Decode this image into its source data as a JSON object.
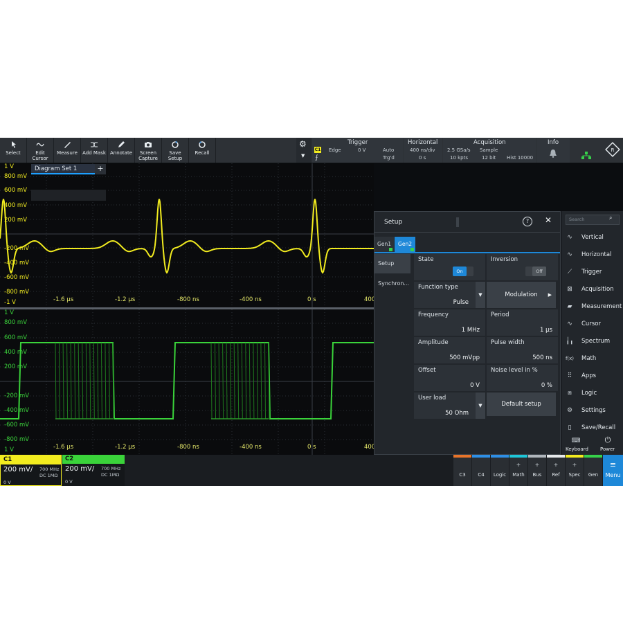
{
  "toolbar": {
    "buttons": [
      {
        "label": "Select",
        "icon": "pointer-icon"
      },
      {
        "label": "Edit Cursor",
        "icon": "cursor-wave-icon"
      },
      {
        "label": "Measure",
        "icon": "ruler-icon"
      },
      {
        "label": "Add Mask",
        "icon": "mask-icon"
      },
      {
        "label": "Annotate",
        "icon": "pencil-icon"
      },
      {
        "label": "Screen Capture",
        "icon": "camera-icon"
      },
      {
        "label": "Save Setup",
        "icon": "save-icon"
      },
      {
        "label": "Recall",
        "icon": "recall-icon"
      }
    ],
    "trigger": {
      "title": "Trigger",
      "channel": "C1",
      "type": "Edge",
      "level": "0 V",
      "mode": "Auto",
      "status": "Trg'd"
    },
    "horizontal": {
      "title": "Horizontal",
      "scale": "400 ns/div",
      "position": "0 s"
    },
    "acquisition": {
      "title": "Acquisition",
      "rate": "2.5 GSa/s",
      "points": "10 kpts",
      "mode": "Sample",
      "bits": "12 bit",
      "hist": "Hist 10000"
    },
    "info": {
      "title": "Info"
    }
  },
  "diagram_tab": {
    "label": "Diagram Set 1",
    "plus": "+"
  },
  "diag1": {
    "y_labels": [
      "1 V",
      "800 mV",
      "600 mV",
      "400 mV",
      "200 mV",
      "-200 mV",
      "-400 mV",
      "-600 mV",
      "-800 mV",
      "-1 V"
    ],
    "x_labels": [
      "-1.6 µs",
      "-1.2 µs",
      "-800 ns",
      "-400 ns",
      "0 s",
      "400"
    ]
  },
  "diag2": {
    "y_labels": [
      "1 V",
      "800 mV",
      "600 mV",
      "400 mV",
      "200 mV",
      "-200 mV",
      "-400 mV",
      "-600 mV",
      "-800 mV",
      "1 V"
    ],
    "x_labels": [
      "-1.6 µs",
      "-1.2 µs",
      "-800 ns",
      "-400 ns",
      "0 s",
      "400"
    ]
  },
  "setup": {
    "title": "Setup",
    "gen_tabs": [
      "Gen1",
      "Gen2"
    ],
    "side": [
      "Setup",
      "Synchron..."
    ],
    "state": {
      "label": "State",
      "on": "On"
    },
    "inversion": {
      "label": "Inversion",
      "off": "Off"
    },
    "function_type": {
      "label": "Function type",
      "value": "Pulse"
    },
    "modulation": {
      "label": "Modulation"
    },
    "frequency": {
      "label": "Frequency",
      "value": "1 MHz"
    },
    "period": {
      "label": "Period",
      "value": "1 µs"
    },
    "amplitude": {
      "label": "Amplitude",
      "value": "500 mVpp"
    },
    "pulse_width": {
      "label": "Pulse width",
      "value": "500 ns"
    },
    "offset": {
      "label": "Offset",
      "value": "0 V"
    },
    "noise": {
      "label": "Noise level in %",
      "value": "0 %"
    },
    "user_load": {
      "label": "User load",
      "value": "50 Ohm"
    },
    "default_setup": {
      "label": "Default setup"
    }
  },
  "menu": {
    "search_placeholder": "Search",
    "items": [
      {
        "label": "Vertical",
        "icon": "sine-icon"
      },
      {
        "label": "Horizontal",
        "icon": "sine-icon"
      },
      {
        "label": "Trigger",
        "icon": "trigger-icon"
      },
      {
        "label": "Acquisition",
        "icon": "acquisition-icon"
      },
      {
        "label": "Measurement",
        "icon": "ruler-icon"
      },
      {
        "label": "Cursor",
        "icon": "cursor-wave-icon"
      },
      {
        "label": "Spectrum",
        "icon": "spectrum-icon"
      },
      {
        "label": "Math",
        "icon": "math-icon"
      },
      {
        "label": "Apps",
        "icon": "apps-icon"
      },
      {
        "label": "Logic",
        "icon": "logic-icon"
      },
      {
        "label": "Settings",
        "icon": "gear-icon"
      },
      {
        "label": "Save/Recall",
        "icon": "file-icon"
      }
    ],
    "keyboard": "Keyboard",
    "power": "Power",
    "menu_label": "Menu"
  },
  "channels": [
    {
      "name": "C1",
      "scale": "200 mV/",
      "bw": "700 MHz",
      "coupling": "DC 1MΩ",
      "offset": "0 V",
      "color": "#f2ec1f"
    },
    {
      "name": "C2",
      "scale": "200 mV/",
      "bw": "700 MHz",
      "coupling": "DC 1MΩ",
      "offset": "0 V",
      "color": "#3ad33a"
    }
  ],
  "bottom_buttons": [
    {
      "label": "C3",
      "color": "#e8742a",
      "plus": false
    },
    {
      "label": "C4",
      "color": "#2e8fe6",
      "plus": false
    },
    {
      "label": "Logic",
      "color": "#2e8fe6",
      "plus": false
    },
    {
      "label": "Math",
      "color": "#1ec6d8",
      "plus": true
    },
    {
      "label": "Bus",
      "color": "#b0b6bc",
      "plus": true
    },
    {
      "label": "Ref",
      "color": "#e7eaec",
      "plus": true
    },
    {
      "label": "Spec",
      "color": "#f2ec1f",
      "plus": true
    },
    {
      "label": "Gen",
      "color": "#36d24a",
      "plus": false
    }
  ],
  "colors": {
    "c1": "#f2ec1f",
    "c2": "#3ad33a",
    "accent": "#1e88d8"
  }
}
